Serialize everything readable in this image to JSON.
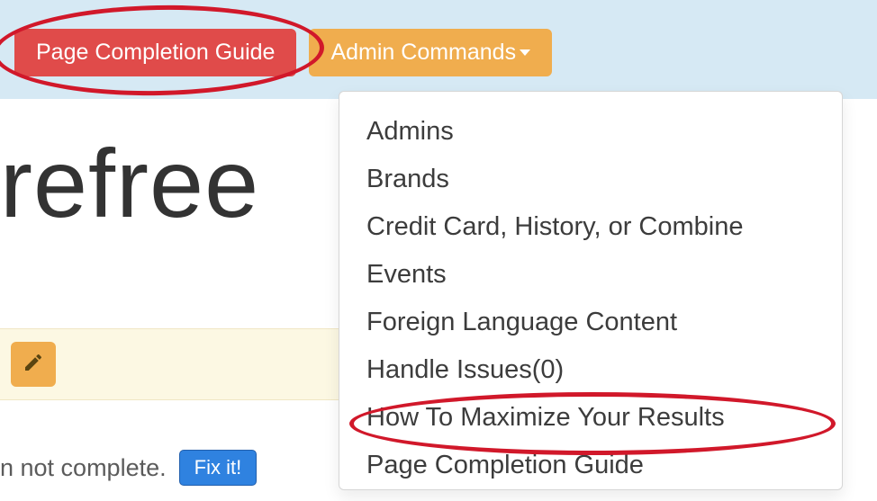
{
  "colors": {
    "topbar_bg": "#d6e9f4",
    "btn_red": "#e04b4a",
    "btn_orange": "#f0ad4e",
    "btn_blue": "#2f82e0",
    "edit_strip_bg": "#fcf8e3",
    "annotation": "#d1182a"
  },
  "topbar": {
    "page_completion_label": "Page Completion Guide",
    "admin_commands_label": "Admin Commands"
  },
  "title_fragment": "refree",
  "status": {
    "text_fragment": "n not complete.",
    "fix_label": "Fix it!"
  },
  "icons": {
    "pencil": "pencil-icon",
    "caret": "caret-down-icon"
  },
  "dropdown": {
    "items": [
      {
        "label": "Admins"
      },
      {
        "label": "Brands"
      },
      {
        "label": "Credit Card, History, or Combine"
      },
      {
        "label": "Events"
      },
      {
        "label": "Foreign Language Content"
      },
      {
        "label": "Handle Issues(0)"
      },
      {
        "label": "How To Maximize Your Results"
      },
      {
        "label": "Page Completion Guide"
      }
    ]
  }
}
